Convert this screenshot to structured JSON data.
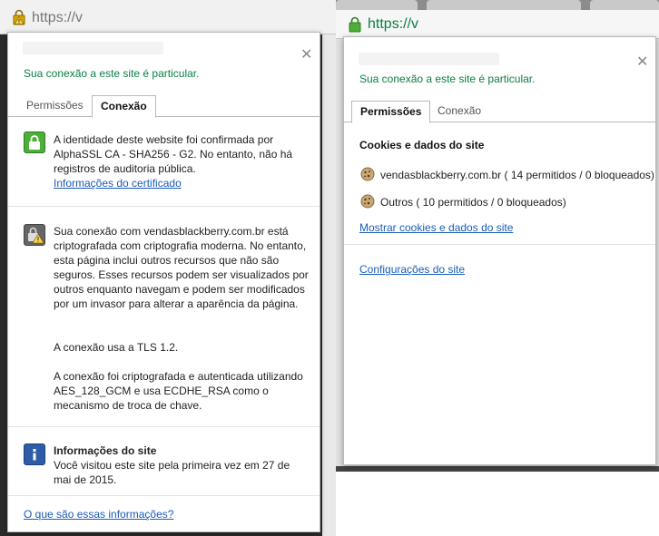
{
  "left_window": {
    "url_fragment": "https://v",
    "bubble": {
      "private_text": "Sua conexão a este site é particular.",
      "tabs": [
        {
          "label": "Permissões",
          "active": false
        },
        {
          "label": "Conexão",
          "active": true
        }
      ],
      "identity_text": "A identidade deste website foi confirmada por AlphaSSL CA - SHA256 - G2. No entanto, não há registros de auditoria pública.",
      "certificate_link": "Informações do certificado",
      "connection_text": "Sua conexão com vendasblackberry.com.br está criptografada com criptografia moderna. No entanto, esta página inclui outros recursos que não são seguros. Esses recursos podem ser visualizados por outros enquanto navegam e podem ser modificados por um invasor para alterar a aparência da página.",
      "tls_text": "A conexão usa a TLS 1.2.",
      "cipher_text": "A conexão foi criptografada e autenticada utilizando AES_128_GCM e usa ECDHE_RSA como o mecanismo de troca de chave.",
      "site_info_title": "Informações do site",
      "site_info_text": "Você visitou este site pela primeira vez em 27 de mai de 2015.",
      "help_link": "O que são essas informações?"
    }
  },
  "right_window": {
    "url_fragment": "https://v",
    "bubble": {
      "private_text": "Sua conexão a este site é particular.",
      "tabs": [
        {
          "label": "Permissões",
          "active": true
        },
        {
          "label": "Conexão",
          "active": false
        }
      ],
      "cookies_heading": "Cookies e dados do site",
      "cookie_rows": [
        {
          "label": "vendasblackberry.com.br ( 14 permitidos / 0 bloqueados)"
        },
        {
          "label": "Outros ( 10 permitidos / 0 bloqueados)"
        }
      ],
      "show_cookies_link": "Mostrar cookies e dados do site",
      "site_settings_link": "Configurações do site"
    }
  },
  "colors": {
    "secure_green": "#0b8043",
    "link_blue": "#1a5cb8",
    "lock_green": "#4caf37",
    "info_blue": "#2e5ca8"
  },
  "icons": [
    "lock-icon",
    "warning-lock-icon",
    "info-icon",
    "cookie-icon",
    "close-icon"
  ]
}
